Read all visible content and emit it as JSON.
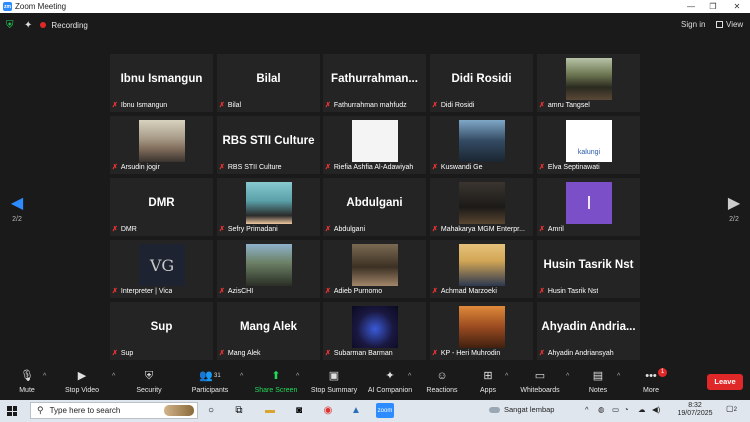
{
  "window": {
    "title": "Zoom Meeting",
    "logo_text": "zm",
    "minimize": "—",
    "restore": "❐",
    "close": "✕"
  },
  "topbar": {
    "recording_label": "Recording",
    "signin_label": "Sign in",
    "view_label": "View"
  },
  "pager": {
    "left_page": "2/2",
    "right_page": "2/2"
  },
  "tiles": [
    {
      "big": "Ibnu Ismangun",
      "label": "Ibnu Ismangun"
    },
    {
      "big": "Bilal",
      "label": "Bilal"
    },
    {
      "big": "Fathurrahman...",
      "label": "Fathurrahman mahfudz"
    },
    {
      "big": "Didi Rosidi",
      "label": "Didi Rosidi"
    },
    {
      "photo": "helmet",
      "label": "amru Tangsel"
    },
    {
      "photo": "man",
      "label": "Arsudin jogir"
    },
    {
      "big": "RBS STII Culture",
      "label": "RBS STII Culture"
    },
    {
      "photo": "stitch",
      "label": "Riefia Ashfia Al-Adawiyah"
    },
    {
      "photo": "car",
      "label": "Kuswandi Ge"
    },
    {
      "photo": "kalungi",
      "photo_text": "kalungi",
      "label": "Elva Septinawati"
    },
    {
      "big": "DMR",
      "label": "DMR"
    },
    {
      "photo": "selfie",
      "label": "Sefry Primadani"
    },
    {
      "big": "Abdulgani",
      "label": "Abdulgani"
    },
    {
      "photo": "dark",
      "label": "Mahakarya MGM Enterpr..."
    },
    {
      "photo": "purple",
      "photo_text": "I",
      "label": "Amril"
    },
    {
      "photo": "vg",
      "photo_text": "VG",
      "label": "Interpreter | Vica"
    },
    {
      "photo": "jeep",
      "label": "AzisCHI"
    },
    {
      "photo": "adieb",
      "label": "Adieb Purnomo"
    },
    {
      "photo": "marzoeki",
      "label": "Achmad Marzoeki"
    },
    {
      "big": "Husin Tasrik Nst",
      "label": "Husin Tasrik Nst"
    },
    {
      "big": "Sup",
      "label": "Sup"
    },
    {
      "big": "Mang Alek",
      "label": "Mang Alek"
    },
    {
      "photo": "space",
      "label": "Subarman Barman"
    },
    {
      "photo": "heri",
      "label": "KP - Heri Muhrodin"
    },
    {
      "big": "Ahyadin  Andria...",
      "label": "Ahyadin Andriansyah"
    }
  ],
  "toolbar": {
    "mute": "Mute",
    "stop_video": "Stop Video",
    "security": "Security",
    "participants": "Participants",
    "participants_count": "31",
    "share_screen": "Share Screen",
    "stop_summary": "Stop Summary",
    "ai_companion": "AI Companion",
    "reactions": "Reactions",
    "apps": "Apps",
    "whiteboards": "Whiteboards",
    "notes": "Notes",
    "more": "More",
    "more_badge": "1",
    "leave": "Leave"
  },
  "taskbar": {
    "search_placeholder": "Type here to search",
    "weather": "Sangat lembap",
    "time": "8:32",
    "date": "19/07/2025",
    "notifications": "2"
  },
  "colors": {
    "accent_blue": "#2d8cff",
    "recording_red": "#e02828",
    "share_green": "#23d959",
    "leave_red": "#e02828"
  }
}
